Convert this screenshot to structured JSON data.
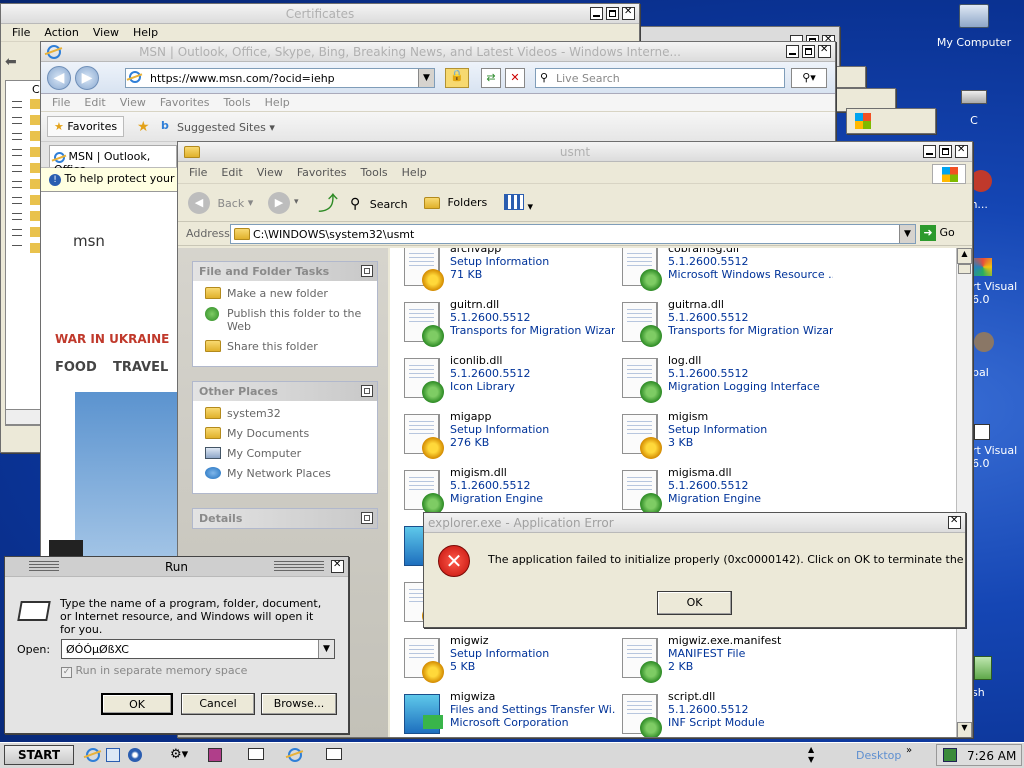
{
  "desktop": {
    "icons": [
      "My Computer",
      "C",
      "agon...",
      "rt Visual\n6.0",
      "bal",
      "rt Visual\n6.0",
      "sh"
    ]
  },
  "cert_window": {
    "title": "Certificates",
    "menu": [
      "File",
      "Action",
      "View",
      "Help"
    ],
    "tree_label": "Ce"
  },
  "ie_window": {
    "title": "MSN | Outlook, Office, Skype, Bing, Breaking News, and Latest Videos - Windows Interne...",
    "url": "https://www.msn.com/?ocid=iehp",
    "search_placeholder": "Live Search",
    "menu": [
      "File",
      "Edit",
      "View",
      "Favorites",
      "Tools",
      "Help"
    ],
    "favorites_label": "Favorites",
    "suggested_sites": "Suggested Sites ▾",
    "tab_label": "MSN | Outlook, Office",
    "infobar": "To help protect your se",
    "page": {
      "logo": "msn",
      "headline": "WAR IN UKRAINE",
      "nav": [
        "FOOD",
        "TRAVEL"
      ]
    }
  },
  "explorer": {
    "title": "usmt",
    "menu": [
      "File",
      "Edit",
      "View",
      "Favorites",
      "Tools",
      "Help"
    ],
    "toolbar": {
      "back": "Back",
      "search": "Search",
      "folders": "Folders"
    },
    "address_label": "Address",
    "address": "C:\\WINDOWS\\system32\\usmt",
    "go": "Go",
    "tasks_header": "File and Folder Tasks",
    "tasks": [
      "Make a new folder",
      "Publish this folder to the Web",
      "Share this folder"
    ],
    "places_header": "Other Places",
    "places": [
      "system32",
      "My Documents",
      "My Computer",
      "My Network Places"
    ],
    "details_header": "Details",
    "files": [
      {
        "name": "archvapp",
        "l2": "Setup Information",
        "l3": "71 KB",
        "kind": "inf"
      },
      {
        "name": "cobramsg.dll",
        "l2": "5.1.2600.5512",
        "l3": "Microsoft Windows Resource ...",
        "kind": "dll"
      },
      {
        "name": "guitrn.dll",
        "l2": "5.1.2600.5512",
        "l3": "Transports for Migration Wizard",
        "kind": "dll"
      },
      {
        "name": "guitrna.dll",
        "l2": "5.1.2600.5512",
        "l3": "Transports for Migration Wizard",
        "kind": "dll"
      },
      {
        "name": "iconlib.dll",
        "l2": "5.1.2600.5512",
        "l3": "Icon Library",
        "kind": "dll"
      },
      {
        "name": "log.dll",
        "l2": "5.1.2600.5512",
        "l3": "Migration Logging Interface",
        "kind": "dll"
      },
      {
        "name": "migapp",
        "l2": "Setup Information",
        "l3": "276 KB",
        "kind": "inf"
      },
      {
        "name": "migism",
        "l2": "Setup Information",
        "l3": "3 KB",
        "kind": "inf"
      },
      {
        "name": "migism.dll",
        "l2": "5.1.2600.5512",
        "l3": "Migration Engine",
        "kind": "dll"
      },
      {
        "name": "migisma.dll",
        "l2": "5.1.2600.5512",
        "l3": "Migration Engine",
        "kind": "dll"
      },
      {
        "name": "migwiz",
        "l2": "Setup Information",
        "l3": "5 KB",
        "kind": "inf"
      },
      {
        "name": "migwiz.exe.manifest",
        "l2": "MANIFEST File",
        "l3": "2 KB",
        "kind": "dll"
      },
      {
        "name": "migwiza",
        "l2": "Files and Settings Transfer Wi...",
        "l3": "Microsoft Corporation",
        "kind": "exe"
      },
      {
        "name": "script.dll",
        "l2": "5.1.2600.5512",
        "l3": "INF Script Module",
        "kind": "dll"
      }
    ]
  },
  "error_dialog": {
    "title": "explorer.exe - Application Error",
    "message": "The application failed to initialize properly (0xc0000142). Click on OK to terminate the application.",
    "ok": "OK"
  },
  "run_dialog": {
    "title": "Run",
    "description": "Type the name of a program, folder, document, or Internet resource, and Windows will open it for you.",
    "open_label": "Open:",
    "value": "ØÓÓµØßXC",
    "checkbox": "Run in separate memory space",
    "ok": "OK",
    "cancel": "Cancel",
    "browse": "Browse..."
  },
  "taskbar": {
    "start": "START",
    "desktop_label": "Desktop",
    "clock": "7:26 AM"
  }
}
